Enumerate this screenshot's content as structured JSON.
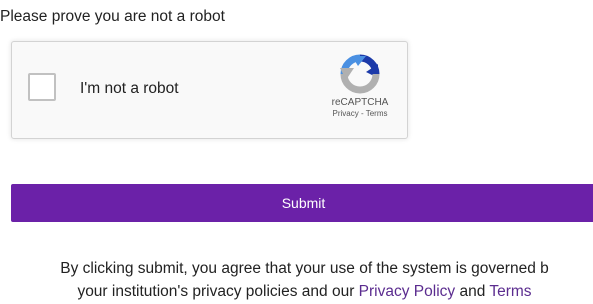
{
  "prompt": "Please prove you are not a robot",
  "captcha": {
    "label": "I'm not a robot",
    "brand": "reCAPTCHA",
    "privacy_link": "Privacy",
    "separator": " - ",
    "terms_link": "Terms",
    "checked": false
  },
  "submit": {
    "label": "Submit"
  },
  "legal": {
    "line1": "By clicking submit, you agree that your use of the system is governed b",
    "line2_prefix": "your institution's privacy policies and our ",
    "privacy_policy_link": "Privacy Policy",
    "and_text": " and ",
    "terms_link": "Terms"
  },
  "colors": {
    "submit_bg": "#6b21a8",
    "link": "#5b2c8f",
    "recaptcha_blue": "#4a90e2",
    "recaptcha_dark_blue": "#1c3aa9",
    "recaptcha_gray": "#b0b0b0"
  },
  "icons": {
    "recaptcha_logo": "recaptcha-logo-icon"
  }
}
